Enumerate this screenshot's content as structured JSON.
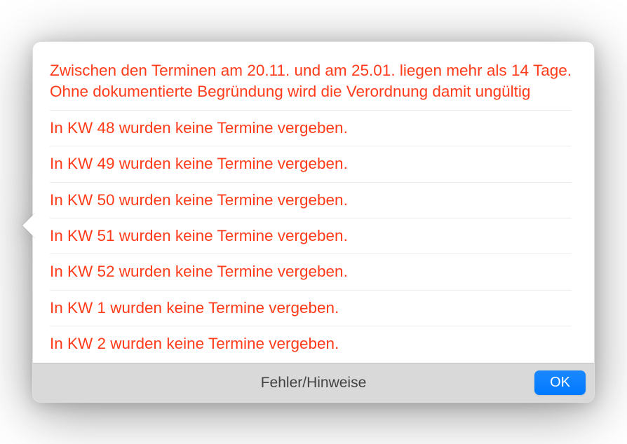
{
  "messages": [
    "Zwischen den Terminen am 20.11. und am 25.01. liegen mehr als 14 Tage. Ohne dokumentierte Begründung wird die Verordnung damit ungültig",
    "In KW 48 wurden keine Termine vergeben.",
    "In KW 49 wurden keine Termine vergeben.",
    "In KW 50 wurden keine Termine vergeben.",
    "In KW 51 wurden keine Termine vergeben.",
    "In KW 52 wurden keine Termine vergeben.",
    "In KW 1 wurden keine Termine vergeben.",
    "In KW 2 wurden keine Termine vergeben."
  ],
  "footer": {
    "title": "Fehler/Hinweise",
    "ok_label": "OK"
  }
}
